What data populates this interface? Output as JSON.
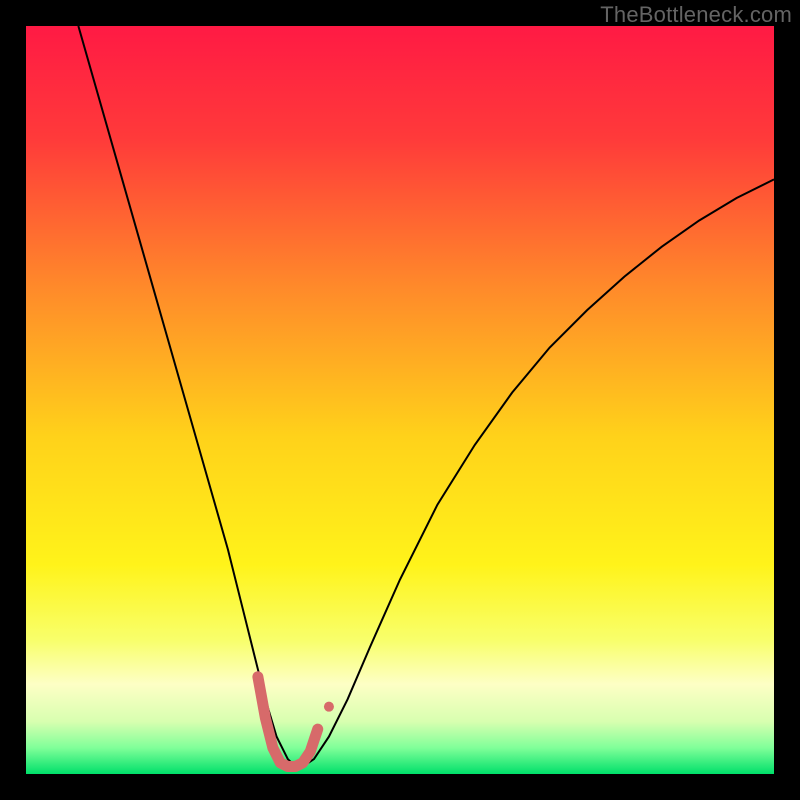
{
  "watermark": "TheBottleneck.com",
  "chart_data": {
    "type": "line",
    "title": "",
    "xlabel": "",
    "ylabel": "",
    "xlim": [
      0,
      100
    ],
    "ylim": [
      0,
      100
    ],
    "background_gradient": {
      "stops": [
        {
          "offset": 0.0,
          "color": "#ff1a44"
        },
        {
          "offset": 0.15,
          "color": "#ff3a3a"
        },
        {
          "offset": 0.35,
          "color": "#ff8a2a"
        },
        {
          "offset": 0.55,
          "color": "#ffd21a"
        },
        {
          "offset": 0.72,
          "color": "#fff31a"
        },
        {
          "offset": 0.82,
          "color": "#f8ff6a"
        },
        {
          "offset": 0.88,
          "color": "#fdffc5"
        },
        {
          "offset": 0.93,
          "color": "#d8ffb0"
        },
        {
          "offset": 0.965,
          "color": "#80ff99"
        },
        {
          "offset": 1.0,
          "color": "#00e06a"
        }
      ]
    },
    "series": [
      {
        "name": "bottleneck-curve",
        "stroke": "#000000",
        "stroke_width": 2.0,
        "x": [
          7,
          9,
          11,
          13,
          15,
          17,
          19,
          21,
          23,
          25,
          27,
          29,
          30.5,
          32,
          33.5,
          35,
          36,
          37,
          38.5,
          40.5,
          43,
          46,
          50,
          55,
          60,
          65,
          70,
          75,
          80,
          85,
          90,
          95,
          100
        ],
        "y": [
          100,
          93,
          86,
          79,
          72,
          65,
          58,
          51,
          44,
          37,
          30,
          22,
          16,
          10,
          5,
          2,
          1,
          1,
          2,
          5,
          10,
          17,
          26,
          36,
          44,
          51,
          57,
          62,
          66.5,
          70.5,
          74,
          77,
          79.5
        ]
      },
      {
        "name": "valley-marker",
        "stroke": "#d76a6a",
        "stroke_width": 11,
        "linecap": "round",
        "x": [
          31.0,
          32.0,
          33.0,
          34.0,
          35.0,
          36.0,
          37.0,
          38.0,
          39.0
        ],
        "y": [
          13.0,
          7.5,
          3.5,
          1.5,
          1.0,
          1.0,
          1.5,
          3.0,
          6.0
        ]
      }
    ],
    "points": [
      {
        "name": "marker-dot",
        "x": 40.5,
        "y": 9.0,
        "r": 5,
        "fill": "#d76a6a"
      }
    ]
  }
}
